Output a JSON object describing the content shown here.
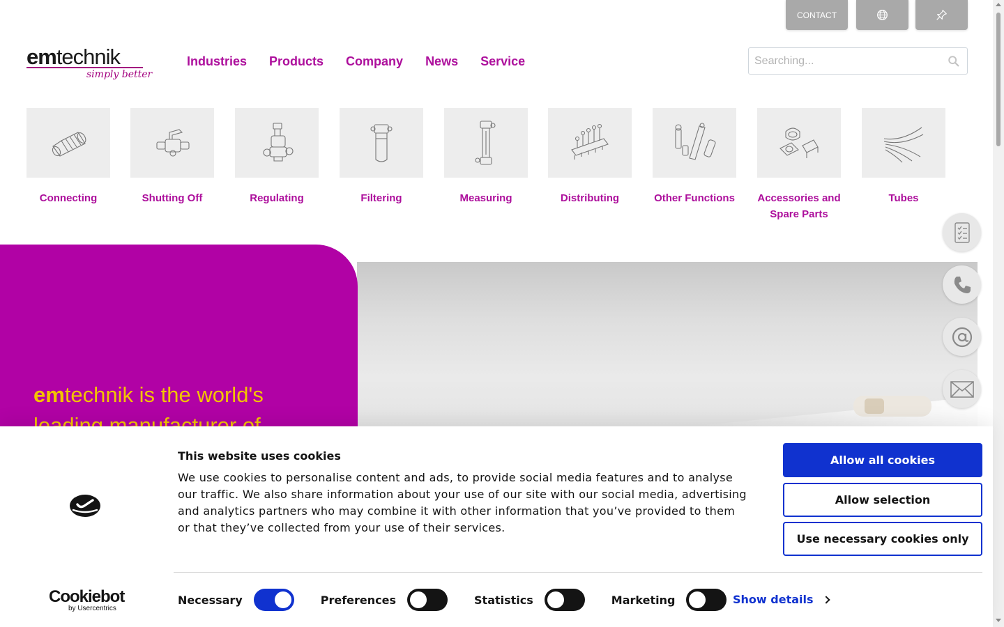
{
  "topbar": {
    "contact_label": "CONTACT",
    "globe_icon": "globe-icon",
    "pin_icon": "pin-icon"
  },
  "logo": {
    "em": "em",
    "technik": "technik",
    "tagline": "simply better"
  },
  "nav": {
    "items": [
      {
        "label": "Industries"
      },
      {
        "label": "Products"
      },
      {
        "label": "Company"
      },
      {
        "label": "News"
      },
      {
        "label": "Service"
      }
    ]
  },
  "search": {
    "placeholder": "Searching..."
  },
  "categories": [
    {
      "label": "Connecting",
      "icon": "fitting-icon"
    },
    {
      "label": "Shutting Off",
      "icon": "valve-icon"
    },
    {
      "label": "Regulating",
      "icon": "regulator-icon"
    },
    {
      "label": "Filtering",
      "icon": "filter-icon"
    },
    {
      "label": "Measuring",
      "icon": "flowmeter-icon"
    },
    {
      "label": "Distributing",
      "icon": "manifold-icon"
    },
    {
      "label": "Other Functions",
      "icon": "other-functions-icon"
    },
    {
      "label": "Accessories and Spare Parts",
      "icon": "accessories-icon"
    },
    {
      "label": "Tubes",
      "icon": "tubes-icon"
    }
  ],
  "hero": {
    "em": "em",
    "line1_rest": "technik is the world's",
    "line2": "leading manufacturer of"
  },
  "side_buttons": [
    {
      "icon": "datasheet-icon"
    },
    {
      "icon": "phone-icon"
    },
    {
      "icon": "at-icon"
    },
    {
      "icon": "envelope-icon"
    }
  ],
  "cookie": {
    "title": "This website uses cookies",
    "body": "We use cookies to personalise content and ads, to provide social media features and to analyse our traffic. We also share information about your use of our site with our social media, advertising and analytics partners who may combine it with other information that you’ve provided to them or that they’ve collected from your use of their services.",
    "allow_all": "Allow all cookies",
    "allow_selection": "Allow selection",
    "necessary_only": "Use necessary cookies only",
    "brand": "Cookiebot",
    "brand_sub": "by Usercentrics",
    "toggles": [
      {
        "label": "Necessary",
        "state": "on"
      },
      {
        "label": "Preferences",
        "state": "off"
      },
      {
        "label": "Statistics",
        "state": "off"
      },
      {
        "label": "Marketing",
        "state": "off"
      }
    ],
    "show_details": "Show details",
    "colors": {
      "accent": "#1032cf",
      "brand_purple": "#b102a5",
      "hero_yellow": "#f3c300"
    }
  }
}
